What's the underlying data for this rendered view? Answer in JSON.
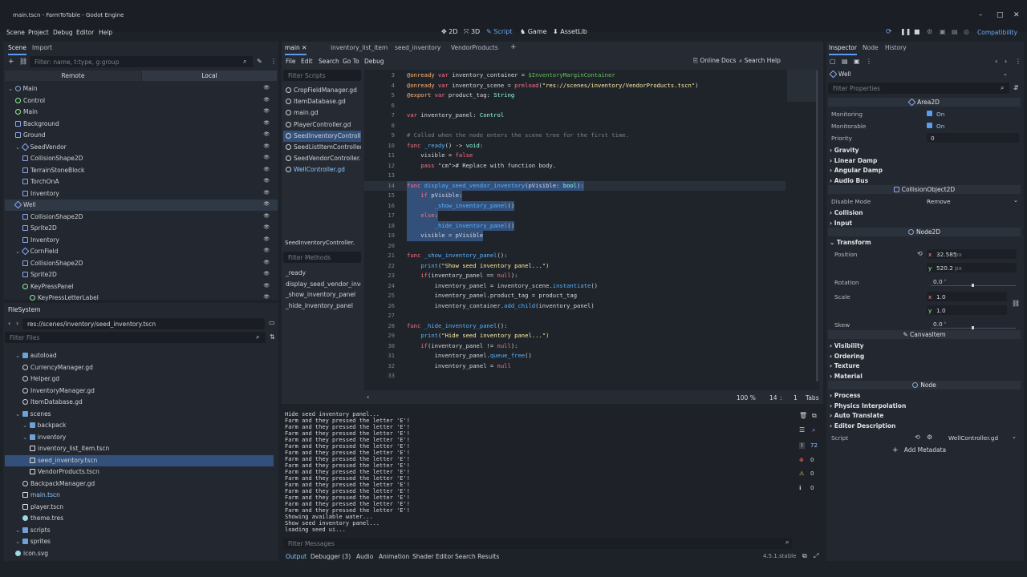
{
  "window": {
    "title": "main.tscn - FarmToTable - Godot Engine"
  },
  "menu": [
    "Scene",
    "Project",
    "Debug",
    "Editor",
    "Help"
  ],
  "modes": [
    "2D",
    "3D",
    "Script",
    "Game",
    "AssetLib"
  ],
  "renderer": "Compatibility",
  "scene_dock": {
    "tabs": [
      "Scene",
      "Import"
    ],
    "filter_placeholder": "Filter: name, t:type, g:group",
    "remote": "Remote",
    "local": "Local",
    "nodes": [
      {
        "name": "Main",
        "depth": 0,
        "icon": "node"
      },
      {
        "name": "Control",
        "depth": 1,
        "icon": "ctrl"
      },
      {
        "name": "Main",
        "depth": 1,
        "icon": "ctrl"
      },
      {
        "name": "Background",
        "depth": 1,
        "icon": "n2d"
      },
      {
        "name": "Ground",
        "depth": 1,
        "icon": "n2d"
      },
      {
        "name": "SeedVendor",
        "depth": 1,
        "icon": "area"
      },
      {
        "name": "CollisionShape2D",
        "depth": 2,
        "icon": "n2d"
      },
      {
        "name": "TerrainStoneBlock",
        "depth": 2,
        "icon": "n2d"
      },
      {
        "name": "TorchOnA",
        "depth": 2,
        "icon": "n2d"
      },
      {
        "name": "Inventory",
        "depth": 2,
        "icon": "n2d"
      },
      {
        "name": "Well",
        "depth": 1,
        "icon": "area",
        "selected": true
      },
      {
        "name": "CollisionShape2D",
        "depth": 2,
        "icon": "n2d"
      },
      {
        "name": "Sprite2D",
        "depth": 2,
        "icon": "n2d"
      },
      {
        "name": "Inventory",
        "depth": 2,
        "icon": "n2d"
      },
      {
        "name": "CornField",
        "depth": 1,
        "icon": "area"
      },
      {
        "name": "CollisionShape2D",
        "depth": 2,
        "icon": "n2d"
      },
      {
        "name": "Sprite2D",
        "depth": 2,
        "icon": "n2d"
      },
      {
        "name": "KeyPressPanel",
        "depth": 2,
        "icon": "ctrl"
      },
      {
        "name": "KeyPressLetterLabel",
        "depth": 3,
        "icon": "ctrl"
      }
    ]
  },
  "filesystem": {
    "title": "FileSystem",
    "path": "res://scenes/inventory/seed_inventory.tscn",
    "filter_placeholder": "Filter Files",
    "items": [
      {
        "name": "autoload",
        "depth": 1,
        "icon": "folder"
      },
      {
        "name": "CurrencyManager.gd",
        "depth": 2,
        "icon": "gear"
      },
      {
        "name": "Helper.gd",
        "depth": 2,
        "icon": "gear"
      },
      {
        "name": "InventoryManager.gd",
        "depth": 2,
        "icon": "gear"
      },
      {
        "name": "ItemDatabase.gd",
        "depth": 2,
        "icon": "gear"
      },
      {
        "name": "scenes",
        "depth": 1,
        "icon": "folder"
      },
      {
        "name": "backpack",
        "depth": 2,
        "icon": "folder"
      },
      {
        "name": "inventory",
        "depth": 2,
        "icon": "folder"
      },
      {
        "name": "inventory_list_item.tscn",
        "depth": 3,
        "icon": "film"
      },
      {
        "name": "seed_inventory.tscn",
        "depth": 3,
        "icon": "film",
        "selected": true
      },
      {
        "name": "VendorProducts.tscn",
        "depth": 3,
        "icon": "film"
      },
      {
        "name": "BackpackManager.gd",
        "depth": 2,
        "icon": "gear"
      },
      {
        "name": "main.tscn",
        "depth": 2,
        "icon": "film",
        "highlight": true
      },
      {
        "name": "player.tscn",
        "depth": 2,
        "icon": "film"
      },
      {
        "name": "theme.tres",
        "depth": 2,
        "icon": "res"
      },
      {
        "name": "scripts",
        "depth": 1,
        "icon": "folder"
      },
      {
        "name": "sprites",
        "depth": 1,
        "icon": "folder"
      },
      {
        "name": "icon.svg",
        "depth": 1,
        "icon": "res"
      }
    ]
  },
  "script_tabs": [
    "main",
    "inventory_list_item",
    "seed_inventory",
    "VendorProducts"
  ],
  "script_menu": [
    "File",
    "Edit",
    "Search",
    "Go To",
    "Debug"
  ],
  "script_tools": [
    "Online Docs",
    "Search Help"
  ],
  "scripts_list": {
    "filter_placeholder": "Filter Scripts",
    "items": [
      "CropFieldManager.gd",
      "ItemDatabase.gd",
      "main.gd",
      "PlayerController.gd",
      "SeedInventoryControlle...",
      "SeedListItemController...",
      "SeedVendorController.gd",
      "WellController.gd"
    ],
    "selected": 4,
    "current_label": "SeedInventoryController.",
    "methods_placeholder": "Filter Methods",
    "methods": [
      "_ready",
      "display_seed_vendor_inve...",
      "_show_inventory_panel",
      "_hide_inventory_panel"
    ]
  },
  "code": [
    {
      "n": "3",
      "t": "@onready var inventory_container = $InventoryMarginContainer"
    },
    {
      "n": "4",
      "t": "@onready var inventory_scene = preload(\"res://scenes/inventory/VendorProducts.tscn\")"
    },
    {
      "n": "5",
      "t": "@export var product_tag: String"
    },
    {
      "n": "6",
      "t": ""
    },
    {
      "n": "7",
      "t": "var inventory_panel: Control"
    },
    {
      "n": "8",
      "t": ""
    },
    {
      "n": "9",
      "t": "# Called when the node enters the scene tree for the first time."
    },
    {
      "n": "10",
      "t": "func _ready() -> void:"
    },
    {
      "n": "11",
      "t": "    visible = false"
    },
    {
      "n": "12",
      "t": "    pass # Replace with function body."
    },
    {
      "n": "13",
      "t": ""
    },
    {
      "n": "14",
      "t": "func display_seed_vendor_inventory(pVisible: bool):"
    },
    {
      "n": "15",
      "t": "    if pVisible:"
    },
    {
      "n": "16",
      "t": "        _show_inventory_panel()"
    },
    {
      "n": "17",
      "t": "    else:"
    },
    {
      "n": "18",
      "t": "        _hide_inventory_panel()"
    },
    {
      "n": "19",
      "t": "    visible = pVisible"
    },
    {
      "n": "20",
      "t": ""
    },
    {
      "n": "21",
      "t": "func _show_inventory_panel():"
    },
    {
      "n": "22",
      "t": "    print(\"Show seed inventory panel...\")"
    },
    {
      "n": "23",
      "t": "    if(inventory_panel == null):"
    },
    {
      "n": "24",
      "t": "        inventory_panel = inventory_scene.instantiate()"
    },
    {
      "n": "25",
      "t": "        inventory_panel.product_tag = product_tag"
    },
    {
      "n": "26",
      "t": "        inventory_container.add_child(inventory_panel)"
    },
    {
      "n": "27",
      "t": ""
    },
    {
      "n": "28",
      "t": "func _hide_inventory_panel():"
    },
    {
      "n": "29",
      "t": "    print(\"Hide seed inventory panel...\")"
    },
    {
      "n": "30",
      "t": "    if(inventory_panel != null):"
    },
    {
      "n": "31",
      "t": "        inventory_panel.queue_free()"
    },
    {
      "n": "32",
      "t": "        inventory_panel = null"
    },
    {
      "n": "33",
      "t": ""
    }
  ],
  "status": {
    "zoom": "100 %",
    "line": "14",
    "col": "1",
    "indent": "Tabs"
  },
  "output": {
    "lines": [
      "Hide seed inventory panel...",
      "Farm and they pressed the letter 'E'!",
      "Farm and they pressed the letter 'E'!",
      "Farm and they pressed the letter 'E'!",
      "Farm and they pressed the letter 'E'!",
      "Farm and they pressed the letter 'E'!",
      "Farm and they pressed the letter 'E'!",
      "Farm and they pressed the letter 'E'!",
      "Farm and they pressed the letter 'E'!",
      "Farm and they pressed the letter 'E'!",
      "Farm and they pressed the letter 'E'!",
      "Farm and they pressed the letter 'E'!",
      "Farm and they pressed the letter 'E'!",
      "Farm and they pressed the letter 'E'!",
      "Farm and they pressed the letter 'E'!",
      "Farm and they pressed the letter 'E'!",
      "Showing available water...",
      "Show seed inventory panel...",
      "loading seed ui..."
    ],
    "filter_placeholder": "Filter Messages",
    "counts": [
      "72",
      "0",
      "0",
      "0"
    ]
  },
  "bottom_tabs": [
    "Output",
    "Debugger (3)",
    "Audio",
    "Animation",
    "Shader Editor",
    "Search Results"
  ],
  "version": "4.5.1.stable",
  "inspector": {
    "tabs": [
      "Inspector",
      "Node",
      "History"
    ],
    "node_name": "Well",
    "filter_placeholder": "Filter Properties",
    "area2d": "Area2D",
    "monitoring": "Monitoring",
    "monitorable": "Monitorable",
    "on": "On",
    "priority": "Priority",
    "priority_val": "0",
    "groups1": [
      "Gravity",
      "Linear Damp",
      "Angular Damp",
      "Audio Bus"
    ],
    "collision_object": "CollisionObject2D",
    "disable_mode": "Disable Mode",
    "disable_val": "Remove",
    "groups2": [
      "Collision",
      "Input"
    ],
    "node2d": "Node2D",
    "transform": "Transform",
    "position": "Position",
    "pos_x": "32.585",
    "pos_y": "520.2",
    "px": "px",
    "rotation": "Rotation",
    "rot_val": "0.0",
    "deg": "°",
    "scale": "Scale",
    "sx": "1.0",
    "sy": "1.0",
    "skew": "Skew",
    "skew_val": "0.0",
    "canvas_item": "CanvasItem",
    "groups3": [
      "Visibility",
      "Ordering",
      "Texture",
      "Material"
    ],
    "node": "Node",
    "groups4": [
      "Process",
      "Physics Interpolation",
      "Auto Translate",
      "Editor Description"
    ],
    "script": "Script",
    "script_val": "WellController.gd",
    "add_metadata": "Add Metadata"
  }
}
